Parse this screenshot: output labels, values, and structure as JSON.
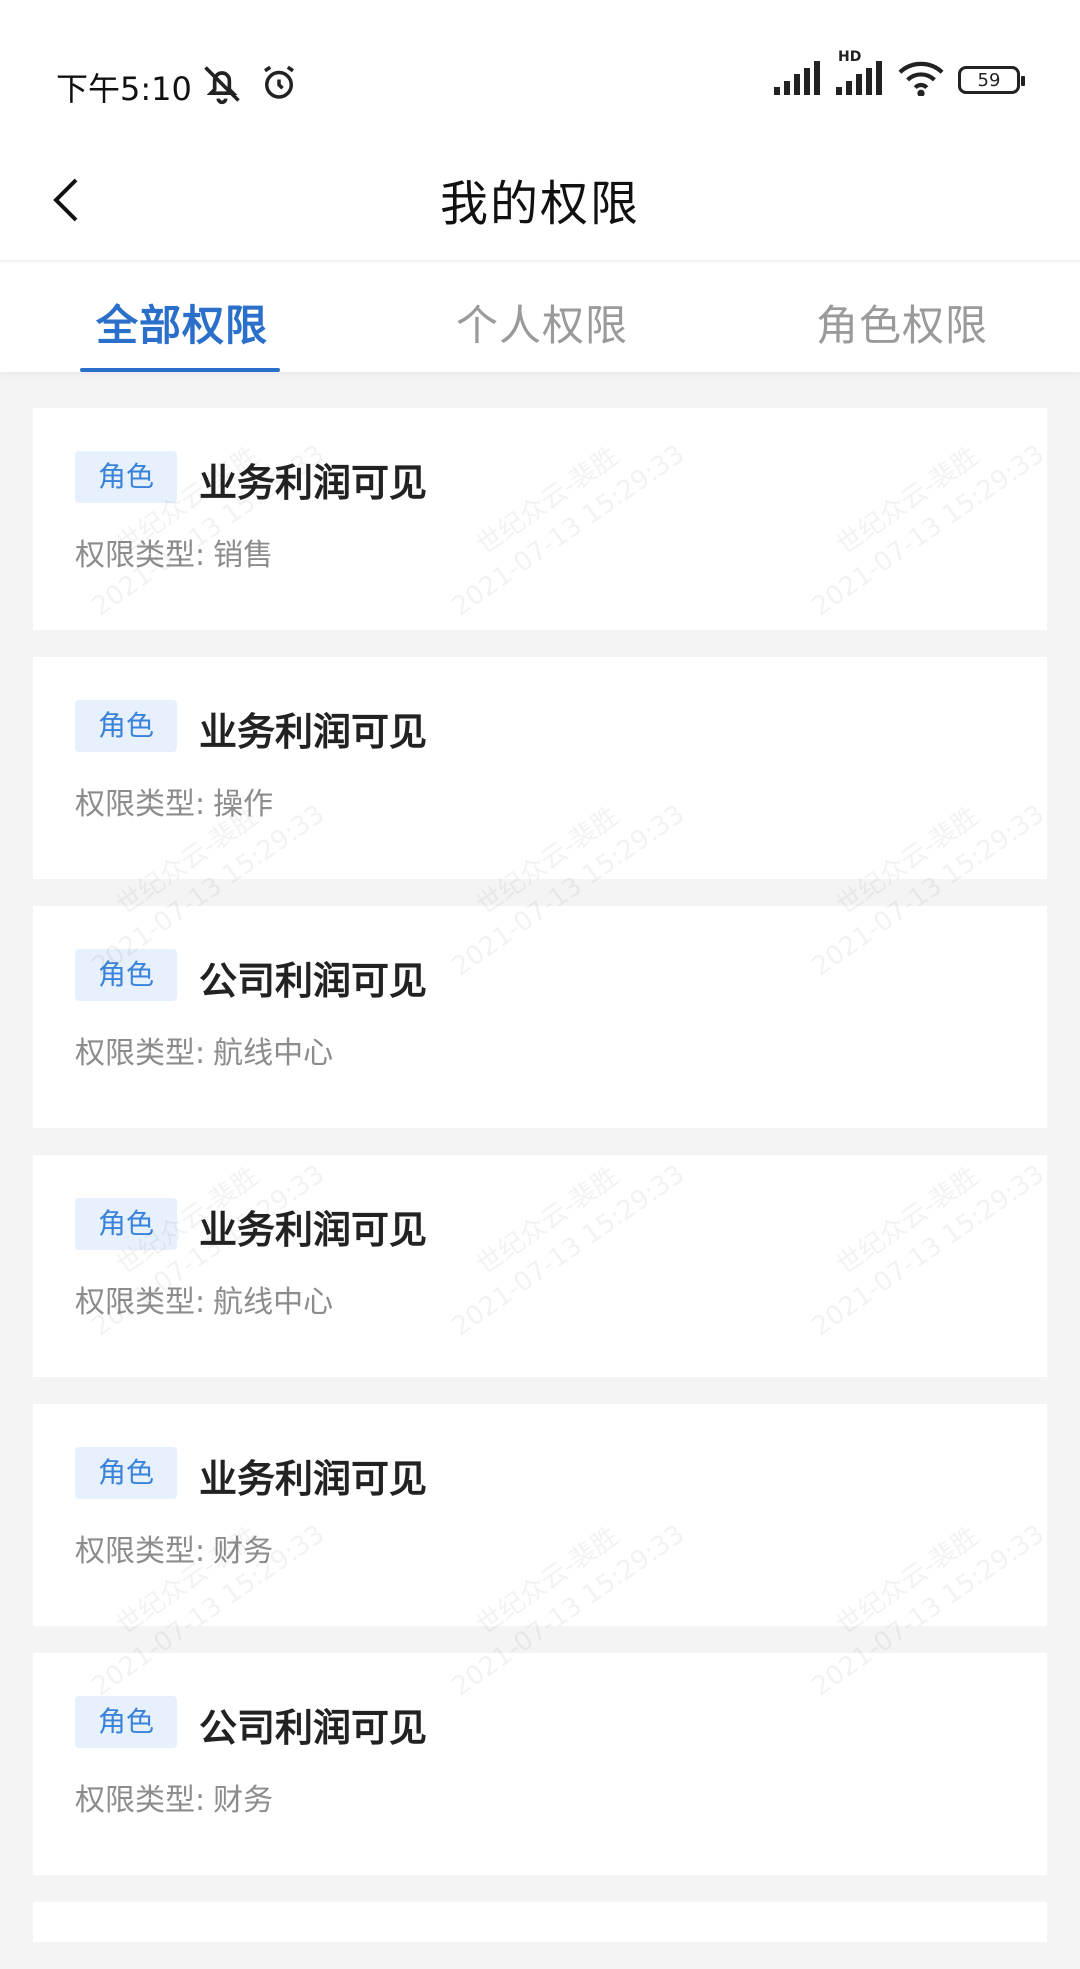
{
  "status_bar": {
    "time": "下午5:10",
    "network_label": "HD",
    "battery": "59"
  },
  "header": {
    "title": "我的权限"
  },
  "tabs": [
    {
      "label": "全部权限",
      "active": true
    },
    {
      "label": "个人权限",
      "active": false
    },
    {
      "label": "角色权限",
      "active": false
    }
  ],
  "items": [
    {
      "badge": "角色",
      "title": "业务利润可见",
      "type_label": "权限类型:",
      "type_value": "销售"
    },
    {
      "badge": "角色",
      "title": "业务利润可见",
      "type_label": "权限类型:",
      "type_value": "操作"
    },
    {
      "badge": "角色",
      "title": "公司利润可见",
      "type_label": "权限类型:",
      "type_value": "航线中心"
    },
    {
      "badge": "角色",
      "title": "业务利润可见",
      "type_label": "权限类型:",
      "type_value": "航线中心"
    },
    {
      "badge": "角色",
      "title": "业务利润可见",
      "type_label": "权限类型:",
      "type_value": "财务"
    },
    {
      "badge": "角色",
      "title": "公司利润可见",
      "type_label": "权限类型:",
      "type_value": "财务"
    }
  ],
  "watermark": {
    "line1": "世纪众云-裴胜",
    "line2": "2021-07-13 15:29:33"
  },
  "colors": {
    "accent": "#2a6fc9",
    "badge_bg": "#e6f1fd",
    "badge_text": "#3a83da"
  }
}
